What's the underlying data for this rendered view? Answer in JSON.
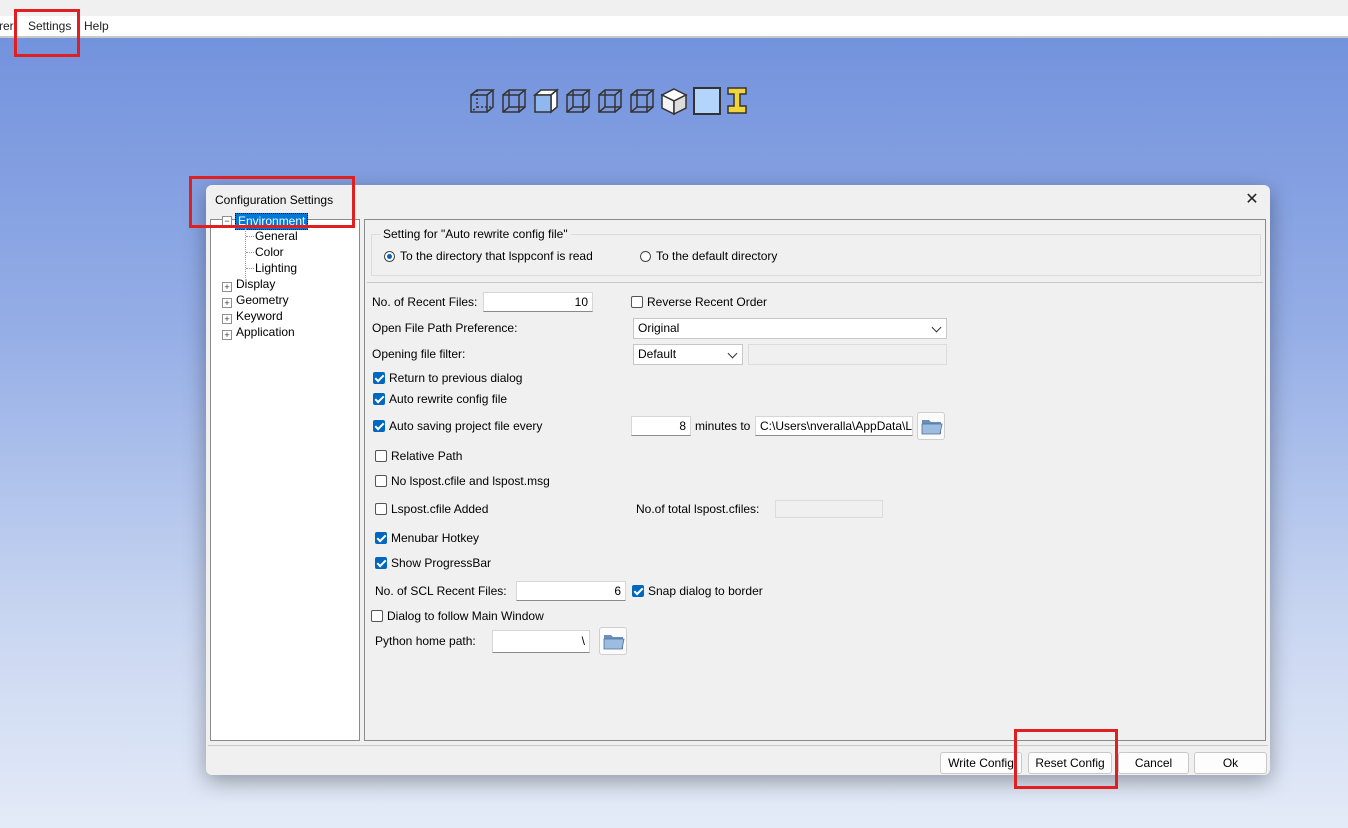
{
  "menubar": {
    "partial_label": "rer",
    "settings_label": "Settings",
    "help_label": "Help"
  },
  "toolbar": {
    "icons": [
      "view-wireframe-icon",
      "view-iso-icon",
      "view-front-icon",
      "view-right-icon",
      "view-back-icon",
      "view-left-icon",
      "view-shaded-icon",
      "view-solid-icon",
      "i-beam-icon"
    ]
  },
  "dialog": {
    "title": "Configuration Settings",
    "close_label": "✕",
    "tree": {
      "environment": "Environment",
      "general": "General",
      "color": "Color",
      "lighting": "Lighting",
      "display": "Display",
      "geometry": "Geometry",
      "keyword": "Keyword",
      "application": "Application"
    },
    "auto_rewrite_group": {
      "title": "Setting for \"Auto rewrite config file\"",
      "option_read_dir": "To the directory that lsppconf is read",
      "option_default_dir": "To the default directory",
      "selected": "option_read_dir"
    },
    "recent_files": {
      "label": "No. of Recent Files:",
      "value": "10"
    },
    "reverse_recent_order": {
      "label": "Reverse Recent Order",
      "checked": false
    },
    "open_file_path": {
      "label": "Open File Path Preference:",
      "value": "Original"
    },
    "opening_filter": {
      "label": "Opening file filter:",
      "value": "Default",
      "extra_value": ""
    },
    "return_prev_dialog": {
      "label": "Return to previous dialog",
      "checked": true
    },
    "auto_rewrite": {
      "label": "Auto rewrite config file",
      "checked": true
    },
    "auto_saving": {
      "label": "Auto saving project file every",
      "checked": true,
      "minutes": "8",
      "minutes_to_label": "minutes to",
      "path": "C:\\Users\\nveralla\\AppData\\L"
    },
    "relative_path": {
      "label": "Relative Path",
      "checked": false
    },
    "no_lspost": {
      "label": "No lspost.cfile and lspost.msg",
      "checked": false
    },
    "lspost_added": {
      "label": "Lspost.cfile Added",
      "checked": false
    },
    "total_cfiles": {
      "label": "No.of total lspost.cfiles:",
      "value": ""
    },
    "menubar_hotkey": {
      "label": "Menubar Hotkey",
      "checked": true
    },
    "show_progressbar": {
      "label": "Show ProgressBar",
      "checked": true
    },
    "scl_recent": {
      "label": "No. of SCL Recent Files:",
      "value": "6"
    },
    "snap_dialog": {
      "label": "Snap dialog to border",
      "checked": true
    },
    "follow_main": {
      "label": "Dialog to follow Main Window",
      "checked": false
    },
    "python_home": {
      "label": "Python home path:",
      "value": "\\"
    },
    "buttons": {
      "write_config": "Write Config",
      "reset_config": "Reset Config",
      "cancel": "Cancel",
      "ok": "Ok"
    }
  },
  "colors": {
    "highlight": "#e02020",
    "accent": "#0067c0",
    "tree_selection": "#0078d7"
  }
}
